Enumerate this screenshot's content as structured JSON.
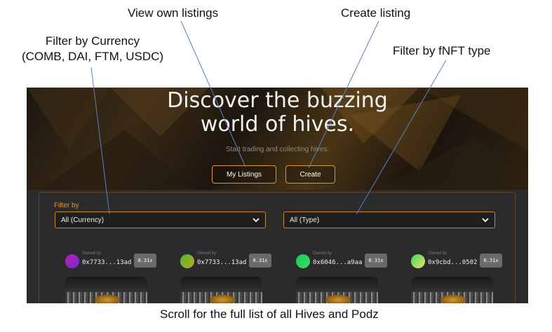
{
  "annotations": {
    "view_own": "View own listings",
    "create_listing": "Create listing",
    "filter_currency_line1": "Filter by Currency",
    "filter_currency_line2": "(COMB, DAI, FTM,  USDC)",
    "filter_type": "Filter by fNFT type",
    "scroll_note": "Scroll for the full list of all Hives and Podz"
  },
  "hero": {
    "title_line1": "Discover the buzzing",
    "title_line2": "world of hives.",
    "subtitle": "Start trading and collecting hives.",
    "my_listings_label": "My Listings",
    "create_label": "Create"
  },
  "filters": {
    "label": "Filter by",
    "currency_selected": "All (Currency)",
    "type_selected": "All (Type)"
  },
  "listings": [
    {
      "owned_by_label": "Owned by",
      "address": "0x7733...13ad",
      "multiplier": "0.31x",
      "avatar_colors": [
        "#c21ea8",
        "#6d2be0"
      ]
    },
    {
      "owned_by_label": "Owned by",
      "address": "0x7733...13ad",
      "multiplier": "0.31x",
      "avatar_colors": [
        "#3fbf3a",
        "#c9a21e"
      ]
    },
    {
      "owned_by_label": "Owned by",
      "address": "0x6046...a9aa",
      "multiplier": "0.31x",
      "avatar_colors": [
        "#19c850",
        "#38e06a"
      ]
    },
    {
      "owned_by_label": "Owned by",
      "address": "0x9cbd...0502",
      "multiplier": "0.31x",
      "avatar_colors": [
        "#43d45a",
        "#e3e86a"
      ]
    }
  ],
  "colors": {
    "accent": "#e09a28",
    "panel_bg": "#2b2a2c",
    "select_border": "#c78b2a"
  }
}
